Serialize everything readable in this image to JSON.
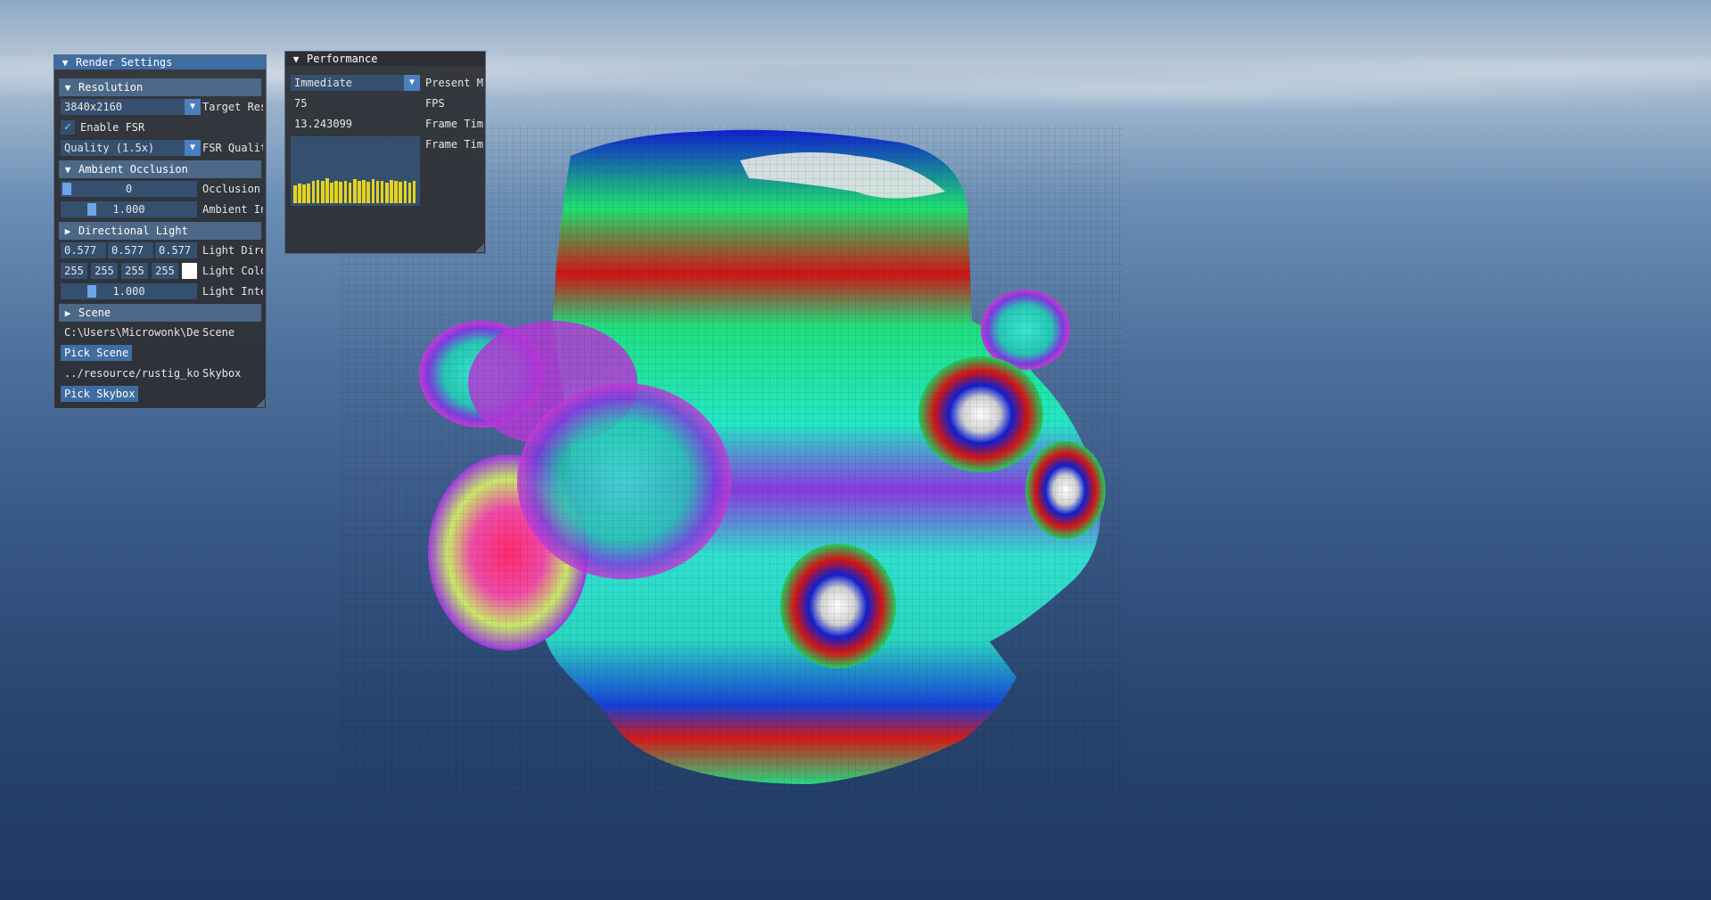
{
  "render_settings": {
    "title": "Render Settings",
    "resolution": {
      "header": "Resolution",
      "target_res_value": "3840x2160",
      "target_res_label": "Target Res",
      "enable_fsr_label": "Enable FSR",
      "enable_fsr_checked": true,
      "fsr_quality_value": "Quality (1.5x)",
      "fsr_quality_label": "FSR Qualit"
    },
    "ambient_occlusion": {
      "header": "Ambient Occlusion",
      "occlusion_value": "0",
      "occlusion_label": "Occlusion",
      "ambient_value": "1.000",
      "ambient_label": "Ambient In"
    },
    "directional_light": {
      "header": "Directional Light",
      "direction_values": [
        "0.577",
        "0.577",
        "0.577"
      ],
      "direction_label": "Light Dire",
      "color_values": [
        "255",
        "255",
        "255",
        "255"
      ],
      "color_swatch": "#ffffff",
      "color_label": "Light Colo",
      "intensity_value": "1.000",
      "intensity_label": "Light Inte"
    },
    "scene": {
      "header": "Scene",
      "scene_path": "C:\\Users\\Microwonk\\De",
      "scene_label": "Scene",
      "pick_scene_label": "Pick Scene",
      "skybox_path": "../resource/rustig_koj",
      "skybox_label": "Skybox",
      "pick_skybox_label": "Pick Skybox"
    }
  },
  "performance": {
    "title": "Performance",
    "present_mode_value": "Immediate",
    "present_mode_label": "Present M",
    "fps_value": "75",
    "fps_label": "FPS",
    "frame_time_value": "13.243099",
    "frame_time_label": "Frame Tim",
    "frame_time_plot_label": "Frame Tim",
    "frame_time_history": [
      0.58,
      0.62,
      0.6,
      0.64,
      0.7,
      0.75,
      0.72,
      0.8,
      0.66,
      0.7,
      0.68,
      0.72,
      0.66,
      0.78,
      0.7,
      0.74,
      0.68,
      0.76,
      0.72,
      0.7,
      0.66,
      0.74,
      0.7,
      0.68,
      0.72,
      0.66,
      0.7
    ]
  },
  "colors": {
    "accent": "#3f6da1",
    "frame_bg": "#35506f",
    "plot_bar": "#e5d21c",
    "window_bg": "#2d2f34"
  }
}
